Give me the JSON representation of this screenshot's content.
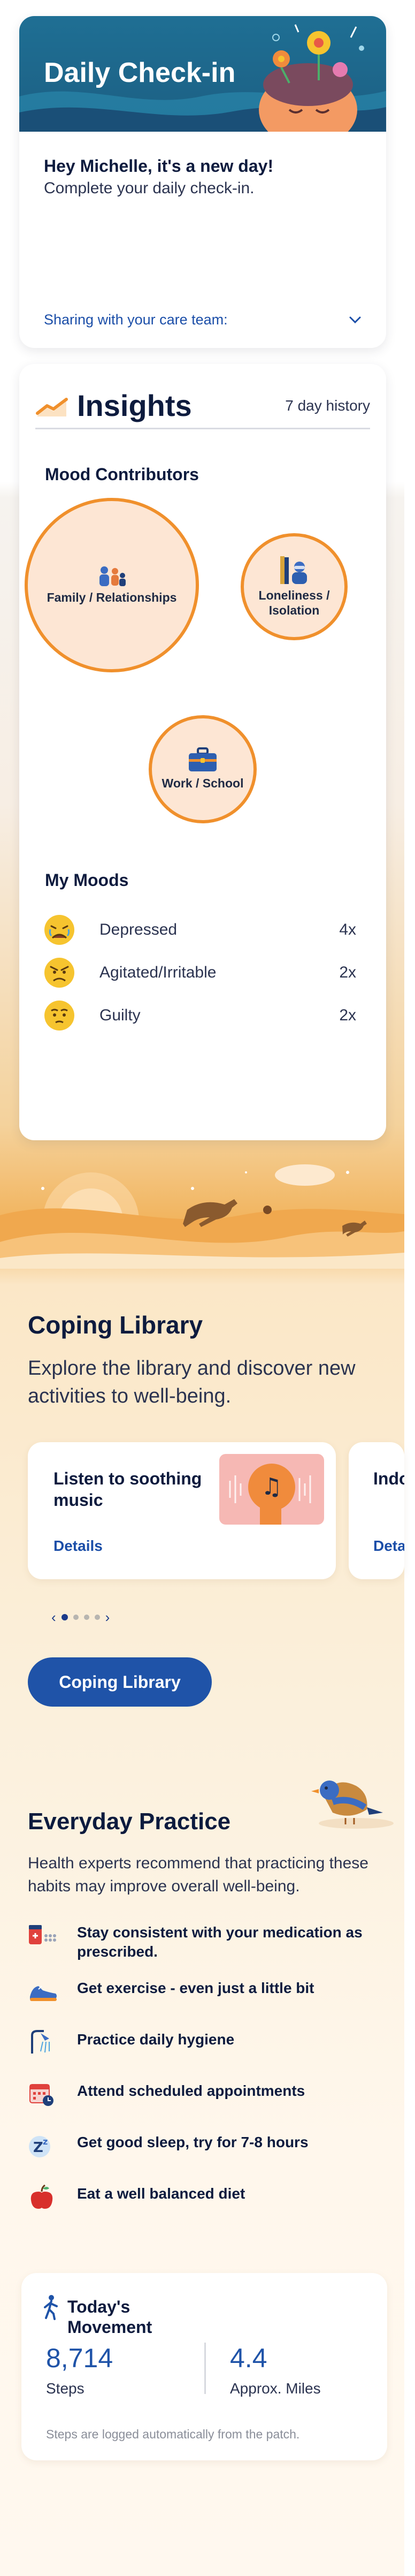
{
  "checkin": {
    "title": "Daily Check-in",
    "greeting": "Hey Michelle, it's a new day!",
    "subtitle": "Complete your daily check-in.",
    "sharing_label": "Sharing with your care team:"
  },
  "insights": {
    "title": "Insights",
    "history": "7 day history",
    "contributors_title": "Mood Contributors",
    "contributors": [
      {
        "label": "Family / Relationships",
        "icon": "family-icon"
      },
      {
        "label": "Loneliness / Isolation",
        "icon": "isolation-icon"
      },
      {
        "label": "Work / School",
        "icon": "briefcase-icon"
      }
    ],
    "moods_title": "My Moods",
    "moods": [
      {
        "name": "Depressed",
        "count": "4x",
        "icon": "depressed-face-icon"
      },
      {
        "name": "Agitated/Irritable",
        "count": "2x",
        "icon": "irritable-face-icon"
      },
      {
        "name": "Guilty",
        "count": "2x",
        "icon": "guilty-face-icon"
      }
    ]
  },
  "coping": {
    "title": "Coping Library",
    "description": "Explore the library and discover new activities to well-being.",
    "cards": [
      {
        "title": "Listen to soothing music",
        "link": "Details",
        "icon": "music-head-icon"
      },
      {
        "title": "Indoor Walk",
        "link": "Details"
      }
    ],
    "button_label": "Coping Library",
    "pager": {
      "total": 4,
      "active": 1
    }
  },
  "practice": {
    "title": "Everyday Practice",
    "description": "Health experts recommend that practicing these habits may improve overall well-being.",
    "items": [
      {
        "text": "Stay consistent with your medication as prescribed.",
        "icon": "medication-icon"
      },
      {
        "text": "Get exercise - even just a little bit",
        "icon": "sneaker-icon"
      },
      {
        "text": "Practice daily hygiene",
        "icon": "shower-icon"
      },
      {
        "text": "Attend scheduled appointments",
        "icon": "calendar-icon"
      },
      {
        "text": "Get good sleep, try for 7-8 hours",
        "icon": "sleep-icon"
      },
      {
        "text": "Eat a well balanced diet",
        "icon": "apple-icon"
      }
    ]
  },
  "movement": {
    "title": "Today's Movement",
    "steps_value": "8,714",
    "steps_label": "Steps",
    "miles_value": "4.4",
    "miles_label": "Approx. Miles",
    "note": "Steps are logged automatically from the patch."
  },
  "colors": {
    "accent_blue": "#1f53a8",
    "bubble_orange": "#f0902c",
    "header_teal": "#1f6f94"
  }
}
